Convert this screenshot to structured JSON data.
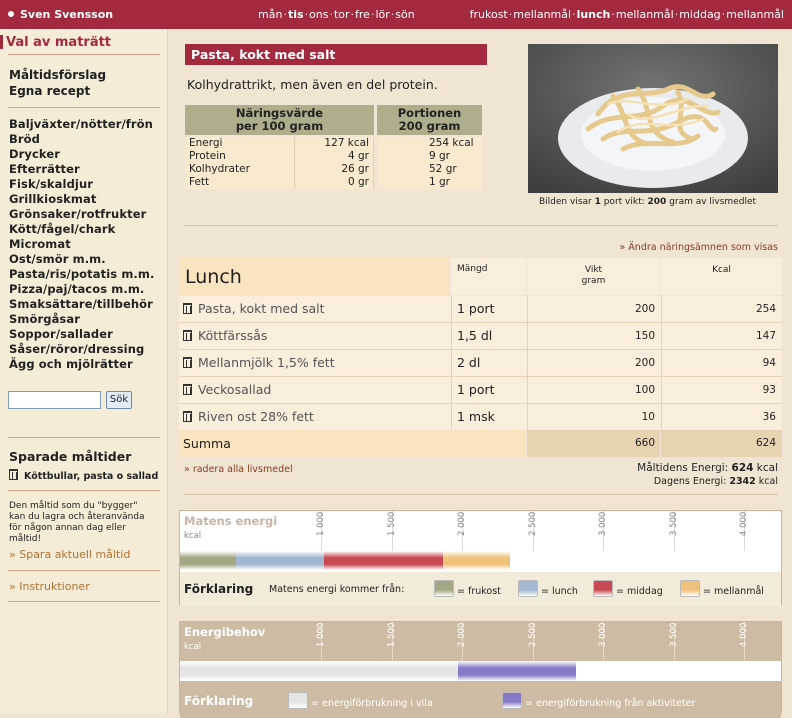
{
  "topbar": {
    "user": "Sven Svensson",
    "days": [
      {
        "label": "mån",
        "active": false
      },
      {
        "label": "tis",
        "active": true
      },
      {
        "label": "ons",
        "active": false
      },
      {
        "label": "tor",
        "active": false
      },
      {
        "label": "fre",
        "active": false
      },
      {
        "label": "lör",
        "active": false
      },
      {
        "label": "sön",
        "active": false
      }
    ],
    "meals": [
      {
        "label": "frukost",
        "active": false
      },
      {
        "label": "mellanmål",
        "active": false
      },
      {
        "label": "lunch",
        "active": true
      },
      {
        "label": "mellanmål",
        "active": false
      },
      {
        "label": "middag",
        "active": false
      },
      {
        "label": "mellanmål",
        "active": false
      }
    ]
  },
  "sidebar": {
    "heading": "Val av maträtt",
    "links": [
      "Måltidsförslag",
      "Egna recept"
    ],
    "categories": [
      "Baljväxter/nötter/frön",
      "Bröd",
      "Drycker",
      "Efterrätter",
      "Fisk/skaldjur",
      "Grillkioskmat",
      "Grönsaker/rotfrukter",
      "Kött/fågel/chark",
      "Micromat",
      "Ost/smör m.m.",
      "Pasta/ris/potatis m.m.",
      "Pizza/paj/tacos m.m.",
      "Smaksättare/tillbehör",
      "Smörgåsar",
      "Soppor/sallader",
      "Såser/röror/dressing",
      "Ägg och mjölrätter"
    ],
    "search_button": "Sök",
    "search_value": "",
    "saved_title": "Sparade måltider",
    "saved_item": "Köttbullar, pasta o sallad",
    "info": [
      "Den måltid som du \"bygger\"",
      "kan du lagra och återanvända",
      "för någon annan dag eller",
      "måltid!"
    ],
    "save_link": "» Spara aktuell måltid",
    "instructions": "» Instruktioner"
  },
  "food": {
    "title": "Pasta, kokt med salt",
    "description": "Kolhydrattrikt, men även en del protein.",
    "photo_caption_pre": "Bilden visar ",
    "photo_caption_port": "1",
    "photo_caption_mid": " port  vikt: ",
    "photo_caption_weight": "200",
    "photo_caption_post": " gram av livsmedlet",
    "nutr_head1": [
      "Näringsvärde",
      "per 100 gram"
    ],
    "nutr_head2": [
      "Portionen",
      "200 gram"
    ],
    "nutrients": [
      {
        "name": "Energi",
        "per100": "127 kcal",
        "portion": "254 kcal"
      },
      {
        "name": "Protein",
        "per100": "4 gr",
        "portion": "9 gr"
      },
      {
        "name": "Kolhydrater",
        "per100": "26 gr",
        "portion": "52 gr"
      },
      {
        "name": "Fett",
        "per100": "0 gr",
        "portion": "1 gr"
      }
    ]
  },
  "change_link": "» Ändra näringsämnen som visas",
  "meal": {
    "title": "Lunch",
    "col_amount": "Mängd",
    "col_weight": [
      "Vikt",
      "gram"
    ],
    "col_kcal": "Kcal",
    "rows": [
      {
        "name": "Pasta, kokt med salt",
        "amount": "1 port",
        "weight": "200",
        "kcal": "254"
      },
      {
        "name": "Köttfärssås",
        "amount": "1,5 dl",
        "weight": "150",
        "kcal": "147"
      },
      {
        "name": "Mellanmjölk 1,5% fett",
        "amount": "2 dl",
        "weight": "200",
        "kcal": "94"
      },
      {
        "name": "Veckosallad",
        "amount": "1 port",
        "weight": "100",
        "kcal": "93"
      },
      {
        "name": "Riven ost 28% fett",
        "amount": "1 msk",
        "weight": "10",
        "kcal": "36"
      }
    ],
    "sum_label": "Summa",
    "sum_weight": "660",
    "sum_kcal": "624",
    "delete_all": "» radera alla livsmedel",
    "meal_energy_label": "Måltidens Energi: ",
    "meal_energy_value": "624",
    "meal_energy_unit": " kcal",
    "day_energy_label": "Dagens Energi: ",
    "day_energy_value": "2342",
    "day_energy_unit": " kcal"
  },
  "chart_data": [
    {
      "type": "bar",
      "title": "Matens energi",
      "unit": "kcal",
      "xlim": [
        0,
        4200
      ],
      "ticks": [
        "1 000",
        "1 500",
        "2 000",
        "2 500",
        "3 000",
        "3 500",
        "4 000"
      ],
      "series": [
        {
          "name": "frukost",
          "value": 400,
          "color": "#a4a882"
        },
        {
          "name": "lunch",
          "value": 624,
          "color": "#a4b7d0"
        },
        {
          "name": "middag",
          "value": 840,
          "color": "#c84a55"
        },
        {
          "name": "mellanmål",
          "value": 478,
          "color": "#efc27b"
        }
      ],
      "legend_title": "Förklaring",
      "legend_intro": "Matens energi kommer från:"
    },
    {
      "type": "bar",
      "title": "Energibehov",
      "unit": "kcal",
      "xlim": [
        0,
        4200
      ],
      "ticks": [
        "1 000",
        "1 500",
        "2 000",
        "2 500",
        "3 000",
        "3 500",
        "4 000"
      ],
      "series": [
        {
          "name": "energiförbrukning i vila",
          "value": 1970,
          "color": "#e4e4e4"
        },
        {
          "name": "energiförbrukning från aktiviteter",
          "value": 840,
          "color": "#8879c6"
        }
      ],
      "legend_title": "Förklaring"
    }
  ]
}
